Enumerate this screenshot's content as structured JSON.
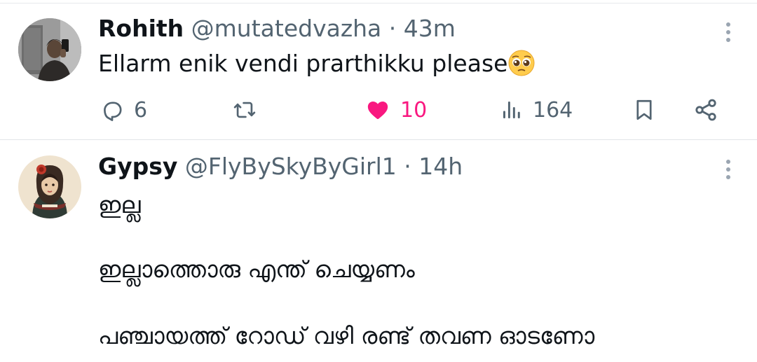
{
  "tweets": [
    {
      "name": "Rohith",
      "handle": "@mutatedvazha",
      "time": "43m",
      "separator": "·",
      "text": "Ellarm enik vendi prarthikku please",
      "emoji_icon": "pleading-face-emoji",
      "actions": {
        "replies": "6",
        "likes": "10",
        "views": "164"
      },
      "liked": true
    },
    {
      "name": "Gypsy",
      "handle": "@FlyBySkyByGirl1",
      "time": "14h",
      "separator": "·",
      "lines": [
        "ഇല്ല",
        "ഇല്ലാത്തൊരു എന്ത് ചെയ്യണം",
        "പഞ്ചായത്ത് റോഡ് വഴി രണ്ട് തവണ ഓടണോ"
      ]
    }
  ],
  "colors": {
    "like": "#f91880",
    "muted": "#536471",
    "text": "#0f1419",
    "divider": "#e1e5e8"
  }
}
